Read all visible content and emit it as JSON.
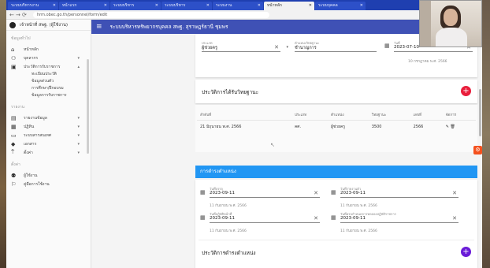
{
  "browser": {
    "tabs": [
      "ระบบบริหารงาน",
      "หน้าแรก",
      "ระบบบริหาร",
      "ระบบบริหาร",
      "ระบบงาน",
      "หน้าหลัก",
      "ระบบบุคคล"
    ],
    "active_tab_index": 5,
    "url": "hrm.obec.go.th/personnel/form/edit",
    "tab_close_icon": "✕"
  },
  "sidebar": {
    "user_label": "เจ้าหน้าที่ สพฐ. (ผู้ใช้งาน)",
    "section_main": "ข้อมูลทั่วไป",
    "items": [
      {
        "icon": "home-icon",
        "label": "หน้าหลัก"
      },
      {
        "icon": "people-icon",
        "label": "บุคลากร"
      },
      {
        "icon": "id-card-icon",
        "label": "ประวัติการรับราชการ"
      }
    ],
    "sub_items": [
      "ทะเบียนประวัติ",
      "ข้อมูลส่วนตัว",
      "การศึกษา/ฝึกอบรม",
      "ข้อมูลการรับราชการ"
    ],
    "section_reports": "รายงาน",
    "report_items": [
      {
        "icon": "folder-icon",
        "label": "รายงานข้อมูล"
      },
      {
        "icon": "calendar-icon",
        "label": "ปฏิทิน"
      },
      {
        "icon": "monitor-icon",
        "label": "ระบบสารสนเทศ"
      },
      {
        "icon": "document-icon",
        "label": "เอกสาร"
      },
      {
        "icon": "pin-icon",
        "label": "ตั้งค่า"
      }
    ],
    "section_settings": "ตั้งค่า",
    "setting_items": [
      {
        "icon": "users-icon",
        "label": "ผู้ใช้งาน"
      },
      {
        "icon": "help-icon",
        "label": "คู่มือการใช้งาน"
      }
    ]
  },
  "appbar": {
    "title": "ระบบบริหารทรัพยากรบุคคล สพฐ. สุราษฎร์ธานี ชุมพร"
  },
  "form_top": {
    "field1_label": "ประเภท",
    "field1_value": "ผู้ช่วยครู",
    "field2_label": "ตำแหน่งวิทยฐานะ",
    "field2_value": "ชำนาญการ",
    "date_label": "วันที่",
    "date_value": "2023-07-10",
    "date_hint": "10 กรกฎาคม พ.ศ. 2566"
  },
  "history_card": {
    "title": "ประวัติการได้รับวิทยฐานะ",
    "add_icon": "+",
    "headers": [
      "ลำดับที่",
      "ประเภท",
      "ตำแหน่ง",
      "วิทยฐานะ",
      "เลขที่",
      "จัดการ"
    ],
    "rows": [
      {
        "date": "21 มิถุนายน พ.ศ. 2566",
        "type": "คศ.",
        "position": "ผู้ช่วยครู",
        "level": "3500",
        "number": "2566",
        "actions": "✎  🗑"
      }
    ]
  },
  "appointment": {
    "band_title": "การดำรงตำแหน่ง",
    "start_label": "วันที่บรรจุ",
    "start_value": "2023-09-11",
    "start_hint": "11 กันยายน พ.ศ. 2566",
    "report_label": "วันที่รายงานตัว",
    "report_value": "2023-09-11",
    "report_hint": "11 กันยายน พ.ศ. 2566",
    "duty_label": "วันที่ปฏิบัติหน้าที่",
    "duty_value": "2023-09-11",
    "duty_hint": "11 กันยายน พ.ศ. 2566",
    "end_label": "วันที่ครบกำหนดการทดลองปฏิบัติราชการ",
    "end_value": "2023-09-11",
    "end_hint": "11 กันยายน พ.ศ. 2566"
  },
  "position_history": {
    "title": "ประวัติการดำรงตำแหน่ง"
  },
  "colors": {
    "appbar": "#3f51b5",
    "band": "#2196f3",
    "fab_red": "#e91e3c",
    "fab_purple": "#6a1bd8",
    "orange": "#f4511e"
  }
}
